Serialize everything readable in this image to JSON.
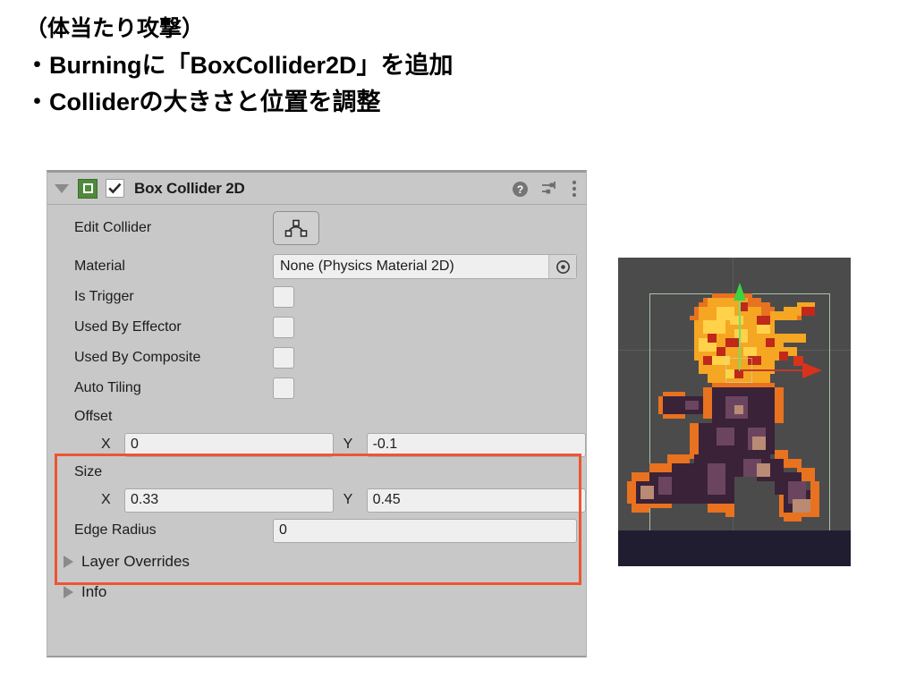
{
  "slide": {
    "lines": [
      "（体当たり攻撃）",
      "・Burningに「BoxCollider2D」を追加",
      "・Colliderの大きさと位置を調整"
    ]
  },
  "inspector": {
    "component_title": "Box Collider 2D",
    "enabled": true,
    "expanded": true,
    "header_icons": {
      "foldout": "triangle-down-icon",
      "component": "box-collider-2d-icon",
      "enable_checkbox": "checkbox-checked-icon",
      "help": "help-icon",
      "preset": "preset-settings-icon",
      "menu": "kebab-menu-icon"
    },
    "rows": {
      "edit_collider": {
        "label": "Edit Collider",
        "button_icon": "edit-collider-icon"
      },
      "material": {
        "label": "Material",
        "value": "None (Physics Material 2D)",
        "picker_icon": "object-picker-icon"
      },
      "is_trigger": {
        "label": "Is Trigger",
        "checked": false
      },
      "used_by_effector": {
        "label": "Used By Effector",
        "checked": false
      },
      "used_by_composite": {
        "label": "Used By Composite",
        "checked": false
      },
      "auto_tiling": {
        "label": "Auto Tiling",
        "checked": false
      },
      "offset": {
        "label": "Offset",
        "x_axis": "X",
        "x_value": "0",
        "y_axis": "Y",
        "y_value": "-0.1"
      },
      "size": {
        "label": "Size",
        "x_axis": "X",
        "x_value": "0.33",
        "y_axis": "Y",
        "y_value": "0.45"
      },
      "edge_radius": {
        "label": "Edge Radius",
        "value": "0"
      },
      "layer_overrides": {
        "label": "Layer Overrides",
        "expanded": false
      },
      "info": {
        "label": "Info",
        "expanded": false
      }
    },
    "highlight_color": "#ee5533",
    "panel_bg": "#c8c8c8",
    "field_bg": "#efefef",
    "component_icon_color": "#4f8a3c"
  },
  "scene_preview": {
    "name": "burning-character-sprite",
    "background_color": "#4b4b4b",
    "ground_color": "#201d31",
    "collider_outline_color": "#a8c3a8",
    "y_axis_color": "#3fd13f",
    "x_axis_color": "#d8321b"
  }
}
